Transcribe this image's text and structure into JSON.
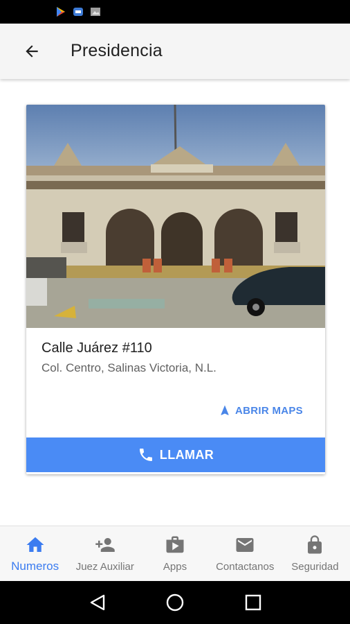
{
  "header": {
    "title": "Presidencia"
  },
  "card": {
    "image_alt": "Presidencia municipal",
    "address_line1": "Calle Juárez #110",
    "address_line2": "Col. Centro, Salinas Victoria, N.L.",
    "maps_label": "ABRIR MAPS",
    "call_label": "LLAMAR"
  },
  "nav": {
    "items": [
      {
        "label": "Numeros",
        "icon": "home-icon",
        "active": true
      },
      {
        "label": "Juez Auxiliar",
        "icon": "person-add-icon",
        "active": false
      },
      {
        "label": "Apps",
        "icon": "shop-icon",
        "active": false
      },
      {
        "label": "Contactanos",
        "icon": "mail-icon",
        "active": false
      },
      {
        "label": "Seguridad",
        "icon": "lock-icon",
        "active": false
      }
    ]
  },
  "colors": {
    "accent": "#4a8bf5",
    "nav_active": "#3b7cf0",
    "inactive": "#757575"
  }
}
